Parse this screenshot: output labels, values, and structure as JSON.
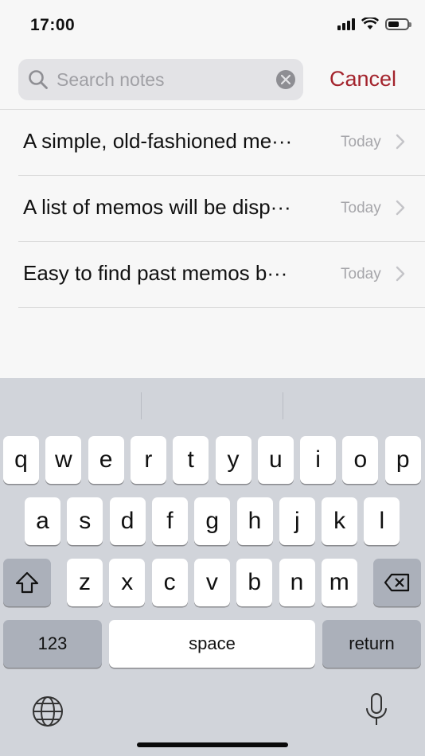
{
  "status_bar": {
    "time": "17:00"
  },
  "search": {
    "placeholder": "Search notes",
    "value": "",
    "cancel_label": "Cancel"
  },
  "notes": [
    {
      "title": "A simple, old-fashioned me···",
      "date": "Today"
    },
    {
      "title": "A list of memos will be disp···",
      "date": "Today"
    },
    {
      "title": "Easy to find past memos b···",
      "date": "Today"
    }
  ],
  "keyboard": {
    "row1": [
      "q",
      "w",
      "e",
      "r",
      "t",
      "y",
      "u",
      "i",
      "o",
      "p"
    ],
    "row2": [
      "a",
      "s",
      "d",
      "f",
      "g",
      "h",
      "j",
      "k",
      "l"
    ],
    "row3": [
      "z",
      "x",
      "c",
      "v",
      "b",
      "n",
      "m"
    ],
    "numbers_label": "123",
    "space_label": "space",
    "return_label": "return"
  },
  "colors": {
    "accent": "#a3232c",
    "keyboard_bg": "#d1d4da"
  }
}
